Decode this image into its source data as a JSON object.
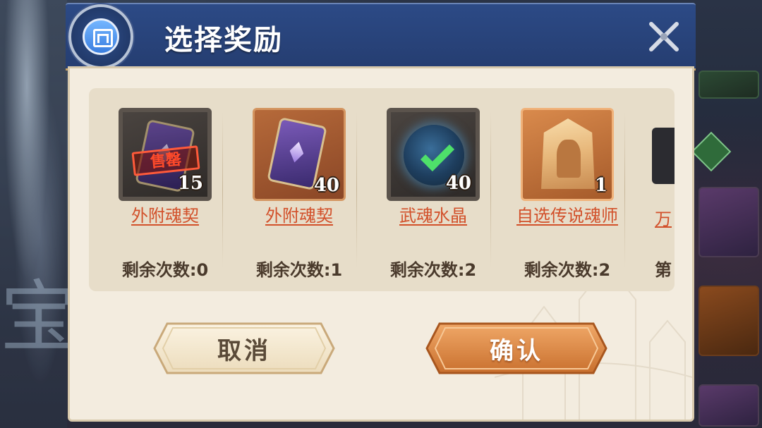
{
  "dialog": {
    "title": "选择奖励",
    "cancel_label": "取消",
    "confirm_label": "确认"
  },
  "rewards": [
    {
      "name": "外附魂契",
      "quantity": "15",
      "remaining": "剩余次数:0",
      "sold_out_label": "售罄",
      "icon": "soul-card-icon",
      "style": "sold-out"
    },
    {
      "name": "外附魂契",
      "quantity": "40",
      "remaining": "剩余次数:1",
      "icon": "soul-card-icon",
      "style": "available"
    },
    {
      "name": "武魂水晶",
      "quantity": "40",
      "remaining": "剩余次数:2",
      "icon": "spirit-crystal-icon",
      "style": "selected"
    },
    {
      "name": "自选传说魂师",
      "quantity": "1",
      "remaining": "剩余次数:2",
      "icon": "legendary-master-icon",
      "style": "available"
    }
  ],
  "partial_reward": {
    "name_fragment": "万",
    "remaining_fragment": "第"
  },
  "background": {
    "watermark_char": "宝"
  },
  "colors": {
    "header_blue": "#2c4a86",
    "panel_cream": "#f3ecdf",
    "link_orange": "#d2502a",
    "confirm_orange": "#d9874a",
    "check_green": "#4ee06a",
    "sold_red": "#ff4a2a"
  }
}
